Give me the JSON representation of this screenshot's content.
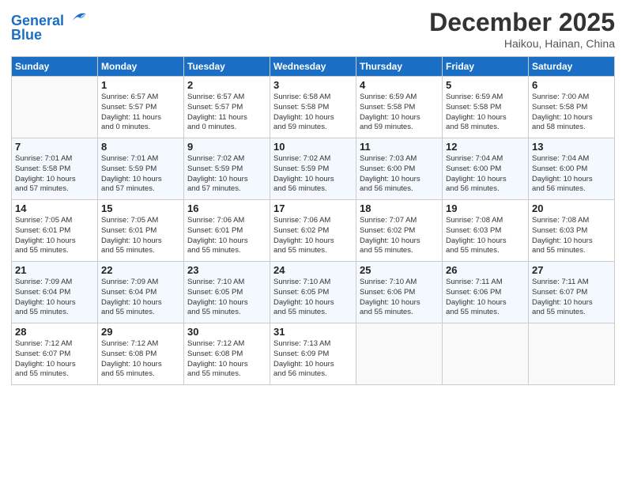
{
  "header": {
    "logo_line1": "General",
    "logo_line2": "Blue",
    "month": "December 2025",
    "location": "Haikou, Hainan, China"
  },
  "weekdays": [
    "Sunday",
    "Monday",
    "Tuesday",
    "Wednesday",
    "Thursday",
    "Friday",
    "Saturday"
  ],
  "weeks": [
    [
      {
        "day": "",
        "info": ""
      },
      {
        "day": "1",
        "info": "Sunrise: 6:57 AM\nSunset: 5:57 PM\nDaylight: 11 hours\nand 0 minutes."
      },
      {
        "day": "2",
        "info": "Sunrise: 6:57 AM\nSunset: 5:57 PM\nDaylight: 11 hours\nand 0 minutes."
      },
      {
        "day": "3",
        "info": "Sunrise: 6:58 AM\nSunset: 5:58 PM\nDaylight: 10 hours\nand 59 minutes."
      },
      {
        "day": "4",
        "info": "Sunrise: 6:59 AM\nSunset: 5:58 PM\nDaylight: 10 hours\nand 59 minutes."
      },
      {
        "day": "5",
        "info": "Sunrise: 6:59 AM\nSunset: 5:58 PM\nDaylight: 10 hours\nand 58 minutes."
      },
      {
        "day": "6",
        "info": "Sunrise: 7:00 AM\nSunset: 5:58 PM\nDaylight: 10 hours\nand 58 minutes."
      }
    ],
    [
      {
        "day": "7",
        "info": "Sunrise: 7:01 AM\nSunset: 5:58 PM\nDaylight: 10 hours\nand 57 minutes."
      },
      {
        "day": "8",
        "info": "Sunrise: 7:01 AM\nSunset: 5:59 PM\nDaylight: 10 hours\nand 57 minutes."
      },
      {
        "day": "9",
        "info": "Sunrise: 7:02 AM\nSunset: 5:59 PM\nDaylight: 10 hours\nand 57 minutes."
      },
      {
        "day": "10",
        "info": "Sunrise: 7:02 AM\nSunset: 5:59 PM\nDaylight: 10 hours\nand 56 minutes."
      },
      {
        "day": "11",
        "info": "Sunrise: 7:03 AM\nSunset: 6:00 PM\nDaylight: 10 hours\nand 56 minutes."
      },
      {
        "day": "12",
        "info": "Sunrise: 7:04 AM\nSunset: 6:00 PM\nDaylight: 10 hours\nand 56 minutes."
      },
      {
        "day": "13",
        "info": "Sunrise: 7:04 AM\nSunset: 6:00 PM\nDaylight: 10 hours\nand 56 minutes."
      }
    ],
    [
      {
        "day": "14",
        "info": "Sunrise: 7:05 AM\nSunset: 6:01 PM\nDaylight: 10 hours\nand 55 minutes."
      },
      {
        "day": "15",
        "info": "Sunrise: 7:05 AM\nSunset: 6:01 PM\nDaylight: 10 hours\nand 55 minutes."
      },
      {
        "day": "16",
        "info": "Sunrise: 7:06 AM\nSunset: 6:01 PM\nDaylight: 10 hours\nand 55 minutes."
      },
      {
        "day": "17",
        "info": "Sunrise: 7:06 AM\nSunset: 6:02 PM\nDaylight: 10 hours\nand 55 minutes."
      },
      {
        "day": "18",
        "info": "Sunrise: 7:07 AM\nSunset: 6:02 PM\nDaylight: 10 hours\nand 55 minutes."
      },
      {
        "day": "19",
        "info": "Sunrise: 7:08 AM\nSunset: 6:03 PM\nDaylight: 10 hours\nand 55 minutes."
      },
      {
        "day": "20",
        "info": "Sunrise: 7:08 AM\nSunset: 6:03 PM\nDaylight: 10 hours\nand 55 minutes."
      }
    ],
    [
      {
        "day": "21",
        "info": "Sunrise: 7:09 AM\nSunset: 6:04 PM\nDaylight: 10 hours\nand 55 minutes."
      },
      {
        "day": "22",
        "info": "Sunrise: 7:09 AM\nSunset: 6:04 PM\nDaylight: 10 hours\nand 55 minutes."
      },
      {
        "day": "23",
        "info": "Sunrise: 7:10 AM\nSunset: 6:05 PM\nDaylight: 10 hours\nand 55 minutes."
      },
      {
        "day": "24",
        "info": "Sunrise: 7:10 AM\nSunset: 6:05 PM\nDaylight: 10 hours\nand 55 minutes."
      },
      {
        "day": "25",
        "info": "Sunrise: 7:10 AM\nSunset: 6:06 PM\nDaylight: 10 hours\nand 55 minutes."
      },
      {
        "day": "26",
        "info": "Sunrise: 7:11 AM\nSunset: 6:06 PM\nDaylight: 10 hours\nand 55 minutes."
      },
      {
        "day": "27",
        "info": "Sunrise: 7:11 AM\nSunset: 6:07 PM\nDaylight: 10 hours\nand 55 minutes."
      }
    ],
    [
      {
        "day": "28",
        "info": "Sunrise: 7:12 AM\nSunset: 6:07 PM\nDaylight: 10 hours\nand 55 minutes."
      },
      {
        "day": "29",
        "info": "Sunrise: 7:12 AM\nSunset: 6:08 PM\nDaylight: 10 hours\nand 55 minutes."
      },
      {
        "day": "30",
        "info": "Sunrise: 7:12 AM\nSunset: 6:08 PM\nDaylight: 10 hours\nand 55 minutes."
      },
      {
        "day": "31",
        "info": "Sunrise: 7:13 AM\nSunset: 6:09 PM\nDaylight: 10 hours\nand 56 minutes."
      },
      {
        "day": "",
        "info": ""
      },
      {
        "day": "",
        "info": ""
      },
      {
        "day": "",
        "info": ""
      }
    ]
  ]
}
